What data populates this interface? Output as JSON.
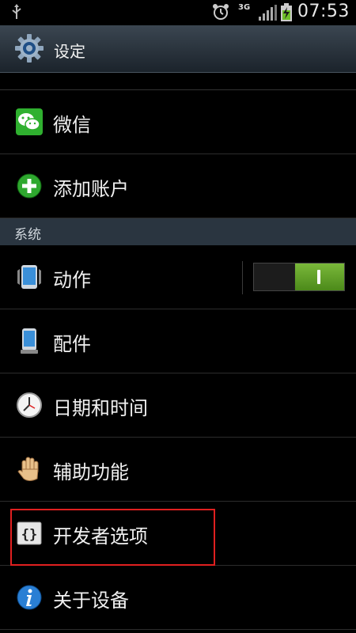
{
  "status_bar": {
    "network": "3G",
    "time": "07:53",
    "icons": [
      "usb-icon",
      "alarm-icon",
      "signal-icon",
      "battery-charging-icon"
    ]
  },
  "action_bar": {
    "title": "设定",
    "icon": "settings-gear-icon"
  },
  "list": {
    "accounts": [
      {
        "label": "微信",
        "icon": "wechat-icon"
      },
      {
        "label": "添加账户",
        "icon": "add-circle-icon"
      }
    ],
    "system_header": "系统",
    "system_items": [
      {
        "label": "动作",
        "icon": "phone-motion-icon",
        "toggle": {
          "state": "on",
          "on_label": "I"
        }
      },
      {
        "label": "配件",
        "icon": "accessory-icon"
      },
      {
        "label": "日期和时间",
        "icon": "clock-icon"
      },
      {
        "label": "辅助功能",
        "icon": "hand-icon"
      },
      {
        "label": "开发者选项",
        "icon": "developer-braces-icon",
        "highlighted": true
      },
      {
        "label": "关于设备",
        "icon": "info-icon"
      }
    ]
  },
  "colors": {
    "highlight_box": "#e02020",
    "toggle_on": "#6aa82e",
    "header_bg": "#2a3540"
  }
}
